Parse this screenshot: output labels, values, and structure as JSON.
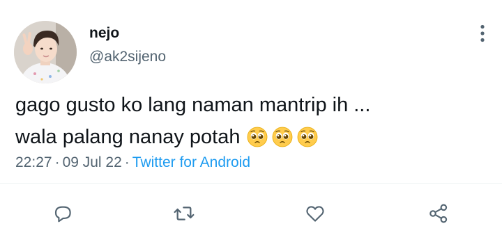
{
  "user": {
    "display_name": "nejo",
    "handle": "@ak2sijeno",
    "avatar": "profile-photo"
  },
  "tweet": {
    "line1": "gago gusto ko lang naman mantrip ih ...",
    "line2": "wala palang nanay potah",
    "emojis": [
      "pleading-face",
      "pleading-face",
      "pleading-face"
    ]
  },
  "meta": {
    "time": "22:27",
    "separator": "·",
    "date": "09 Jul 22",
    "source": "Twitter for Android"
  },
  "actions": [
    {
      "icon": "reply-icon"
    },
    {
      "icon": "retweet-icon"
    },
    {
      "icon": "like-icon"
    },
    {
      "icon": "share-icon"
    }
  ],
  "colors": {
    "text": "#0f1419",
    "secondary": "#536471",
    "link": "#1d9bf0",
    "divider": "#eff3f4"
  }
}
